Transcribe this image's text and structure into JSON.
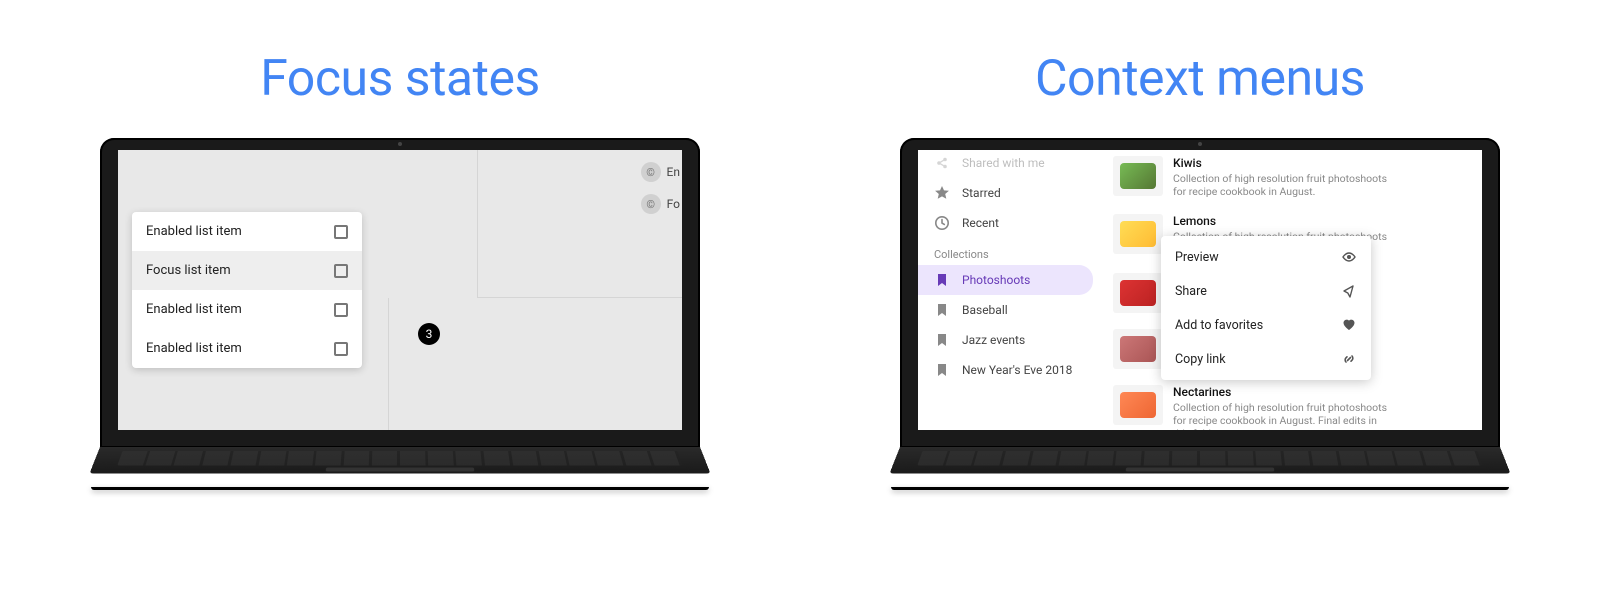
{
  "headings": {
    "left": "Focus states",
    "right": "Context menus"
  },
  "focus": {
    "chips": [
      {
        "icon": "©",
        "label": "En"
      },
      {
        "icon": "©",
        "label": "Fo"
      }
    ],
    "list": [
      {
        "label": "Enabled list item",
        "focused": false
      },
      {
        "label": "Focus list item",
        "focused": true
      },
      {
        "label": "Enabled list item",
        "focused": false
      },
      {
        "label": "Enabled list item",
        "focused": false
      }
    ],
    "bubble": "3"
  },
  "ctx": {
    "sidebar_top": [
      {
        "icon": "share",
        "label": "Shared with me"
      },
      {
        "icon": "star",
        "label": "Starred"
      },
      {
        "icon": "clock",
        "label": "Recent"
      }
    ],
    "sidebar_header": "Collections",
    "sidebar_collections": [
      {
        "icon": "bookmark",
        "label": "Photoshoots",
        "selected": true
      },
      {
        "icon": "bookmark",
        "label": "Baseball",
        "selected": false
      },
      {
        "icon": "bookmark",
        "label": "Jazz events",
        "selected": false
      },
      {
        "icon": "bookmark",
        "label": "New Year's Eve 2018",
        "selected": false
      }
    ],
    "items": [
      {
        "title": "Kiwis",
        "sub": "Collection of high resolution fruit photoshoots for recipe cookbook in August.",
        "swatch": "linear-gradient(135deg,#7b5, #573)"
      },
      {
        "title": "Lemons",
        "sub": "Collection of high resolution fruit photoshoots for",
        "swatch": "linear-gradient(135deg,#fd5, #fb3)"
      },
      {
        "title": "",
        "sub": "",
        "swatch": "linear-gradient(135deg,#d33, #b22)"
      },
      {
        "title": "",
        "sub": "",
        "swatch": "linear-gradient(135deg,#c77, #a55)"
      },
      {
        "title": "Nectarines",
        "sub": "Collection of high resolution fruit photoshoots for recipe cookbook in August. Final edits in this fold",
        "swatch": "linear-gradient(135deg,#f85, #e63)"
      }
    ],
    "menu": [
      {
        "label": "Preview",
        "icon": "eye"
      },
      {
        "label": "Share",
        "icon": "share-out"
      },
      {
        "label": "Add to favorites",
        "icon": "heart"
      },
      {
        "label": "Copy link",
        "icon": "link"
      }
    ]
  }
}
